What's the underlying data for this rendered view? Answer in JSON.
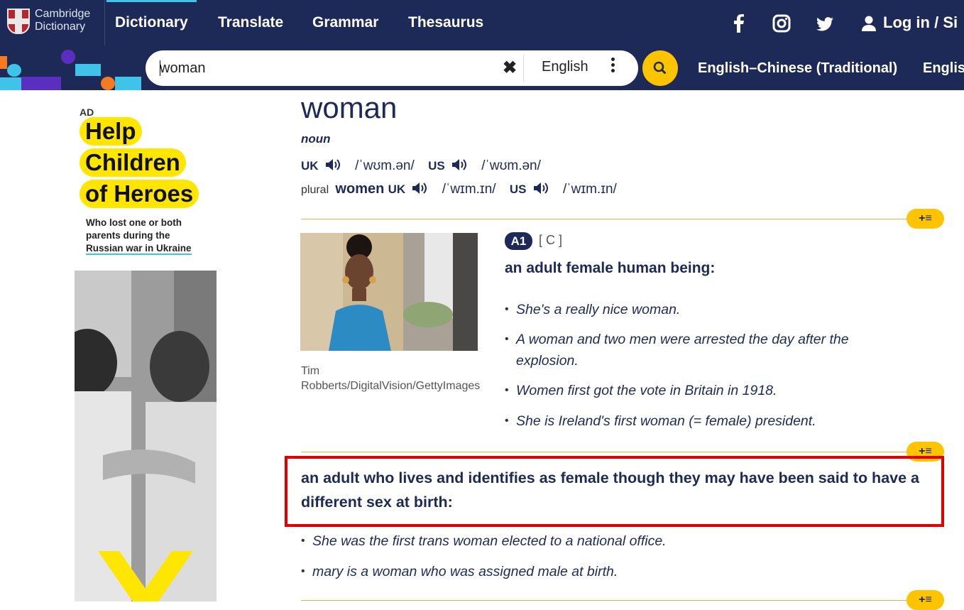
{
  "header": {
    "logo_line1": "Cambridge",
    "logo_line2": "Dictionary",
    "nav": [
      "Dictionary",
      "Translate",
      "Grammar",
      "Thesaurus"
    ],
    "login_label": "Log in / Si"
  },
  "search": {
    "value": "woman",
    "clear_symbol": "✖",
    "language": "English",
    "dictionaries": [
      "English–Chinese (Traditional)",
      "Englis"
    ]
  },
  "ad": {
    "label": "AD",
    "headline": [
      "Help",
      "Children",
      "of Heroes"
    ],
    "sub_line1": "Who lost one or both",
    "sub_line2": "parents during the",
    "sub_line3": "Russian war in Ukraine"
  },
  "entry": {
    "headword": "woman",
    "pos": "noun",
    "uk_label": "UK",
    "us_label": "US",
    "ipa_uk": "/ˈwʊm.ən/",
    "ipa_us": "/ˈwʊm.ən/",
    "plural_label": "plural",
    "plural_word": "women",
    "plural_ipa_uk": "/ˈwɪm.ɪn/",
    "plural_ipa_us": "/ˈwɪm.ɪn/",
    "photo_credit": "Tim Robberts/DigitalVision/GettyImages",
    "sense1": {
      "level": "A1",
      "grammar": "[ C ]",
      "definition": "an adult female human being:",
      "examples": [
        "She's a really nice woman.",
        "A woman and two men were arrested the day after the explosion.",
        "Women first got the vote in Britain in 1918.",
        "She is Ireland's first woman (= female) president."
      ]
    },
    "sense2": {
      "definition": "an adult who lives and identifies as female though they may have been said to have a different sex at birth:",
      "examples": [
        "She was the first trans woman elected to a national office.",
        "mary is a woman who was assigned male at birth."
      ]
    },
    "add_to_list_label": "+≡"
  },
  "colors": {
    "navy": "#1d2a57",
    "accent_yellow": "#fec400",
    "highlight_red": "#e00000"
  }
}
